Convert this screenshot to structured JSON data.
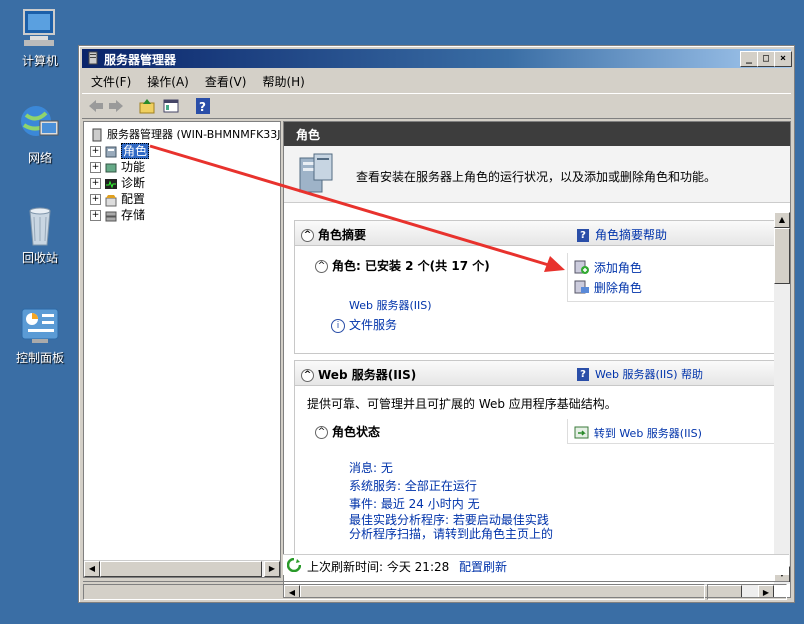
{
  "desktop": {
    "icons": [
      {
        "label": "计算机",
        "icon": "computer-icon"
      },
      {
        "label": "网络",
        "icon": "network-icon"
      },
      {
        "label": "回收站",
        "icon": "recycle-bin-icon"
      },
      {
        "label": "控制面板",
        "icon": "control-panel-icon"
      }
    ]
  },
  "window": {
    "title": "服务器管理器",
    "controls": {
      "minimize": "_",
      "maximize": "□",
      "close": "×"
    }
  },
  "menu": [
    "文件(F)",
    "操作(A)",
    "查看(V)",
    "帮助(H)"
  ],
  "tree": {
    "root": "服务器管理器 (WIN-BHMNMFK33J",
    "items": [
      "角色",
      "功能",
      "诊断",
      "配置",
      "存储"
    ]
  },
  "right": {
    "header": "角色",
    "intro": "查看安装在服务器上角色的运行状况，以及添加或删除角色和功能。",
    "summary": {
      "title": "角色摘要",
      "help": "角色摘要帮助",
      "roles_label": "角色: 已安装 2 个(共 17 个)",
      "add": "添加角色",
      "remove": "删除角色",
      "installed": [
        "Web 服务器(IIS)",
        "文件服务"
      ]
    },
    "web": {
      "title": "Web 服务器(IIS)",
      "help": "Web 服务器(IIS) 帮助",
      "desc": "提供可靠、可管理并且可扩展的 Web 应用程序基础结构。",
      "status_title": "角色状态",
      "goto": "转到 Web 服务器(IIS)",
      "lines": [
        "消息: 无",
        "系统服务: 全部正在运行",
        "事件: 最近 24 小时内 无",
        "最佳实践分析程序: 若要启动最佳实践",
        "分析程序扫描，请转到此角色主页上的"
      ]
    },
    "status": {
      "refresh_time": "上次刷新时间: 今天 21:28",
      "refresh_link": "配置刷新"
    }
  },
  "colors": {
    "desktop": "#3a6ea5",
    "header": "#3d3d3d",
    "link": "#0033aa",
    "arrow": "#e8322d"
  }
}
